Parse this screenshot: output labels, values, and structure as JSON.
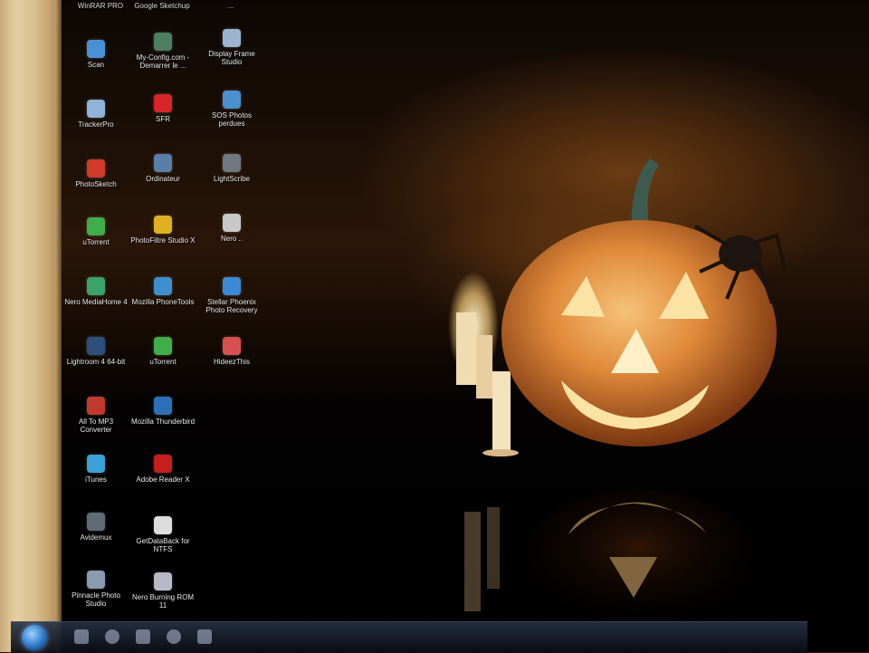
{
  "desktop": {
    "top_labels": [
      "WinRAR PRO",
      "Google Sketchup",
      "..."
    ],
    "icons": [
      {
        "label": "Scan",
        "icon": "scanner-icon",
        "color": "#4a90d9"
      },
      {
        "label": "TrackerPro",
        "icon": "tool-icon",
        "color": "#8fb3d9"
      },
      {
        "label": "PhotoSketch",
        "icon": "red-app-icon",
        "color": "#d23a2a"
      },
      {
        "label": "uTorrent",
        "icon": "utorrent-icon",
        "color": "#3fae4a"
      },
      {
        "label": "Nero MediaHome 4",
        "icon": "nero-icon",
        "color": "#3ca36b"
      },
      {
        "label": "Lightroom 4 64-bit",
        "icon": "lightroom-icon",
        "color": "#2d4f7a"
      },
      {
        "label": "All To MP3 Converter",
        "icon": "converter-icon",
        "color": "#c0392b"
      },
      {
        "label": "iTunes",
        "icon": "itunes-icon",
        "color": "#3aa0d8"
      },
      {
        "label": "Avidemux",
        "icon": "avidemux-icon",
        "color": "#5f6c78"
      },
      {
        "label": "Pinnacle Photo Studio",
        "icon": "photo-studio-icon",
        "color": "#8a9bb0"
      },
      {
        "label": "My-Config.com - Demarrer le ...",
        "icon": "config-icon",
        "color": "#4e7f62"
      },
      {
        "label": "SFR",
        "icon": "sfr-icon",
        "color": "#d9242a"
      },
      {
        "label": "Ordinateur",
        "icon": "computer-icon",
        "color": "#5a7ea8"
      },
      {
        "label": "PhotoFiltre Studio X",
        "icon": "photofiltre-icon",
        "color": "#e0b020"
      },
      {
        "label": "Mozilla PhoneTools",
        "icon": "phonetools-icon",
        "color": "#3d8fd0"
      },
      {
        "label": "uTorrent",
        "icon": "utorrent-icon",
        "color": "#3fae4a"
      },
      {
        "label": "Mozilla Thunderbird",
        "icon": "thunderbird-icon",
        "color": "#2f6fb8"
      },
      {
        "label": "Adobe Reader X",
        "icon": "adobe-reader-icon",
        "color": "#c81e1e"
      },
      {
        "label": "GetDataBack for NTFS",
        "icon": "getdataback-icon",
        "color": "#dddddd"
      },
      {
        "label": "Nero Burning ROM 11",
        "icon": "nero-burning-icon",
        "color": "#b8b8c8"
      },
      {
        "label": "Display Frame Studio",
        "icon": "display-icon",
        "color": "#9bb4d0"
      },
      {
        "label": "SOS Photos perdues",
        "icon": "sos-photos-icon",
        "color": "#4a8fd0"
      },
      {
        "label": "LightScribe",
        "icon": "lightscribe-icon",
        "color": "#707880"
      },
      {
        "label": "Nero ..",
        "icon": "nero-disc-icon",
        "color": "#c8c8c8"
      },
      {
        "label": "Stellar Phoenix Photo Recovery",
        "icon": "stellar-icon",
        "color": "#3b8ad8"
      },
      {
        "label": "HideezThis",
        "icon": "hide-icon",
        "color": "#d85050"
      }
    ]
  },
  "taskbar": {
    "pinned": [
      "explorer-icon",
      "media-icon",
      "folder-icon",
      "browser-icon",
      "window-icon"
    ]
  }
}
